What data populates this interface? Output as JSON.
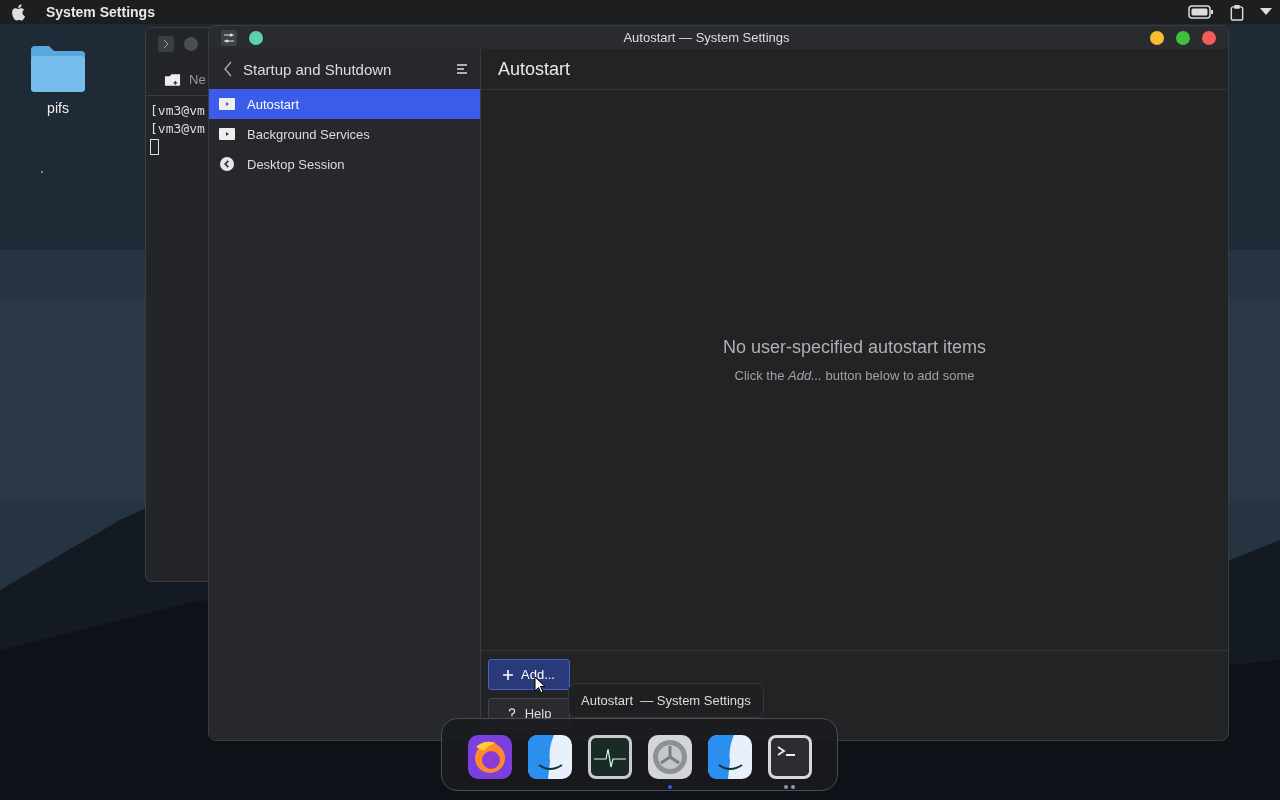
{
  "menubar": {
    "app_name": "System Settings"
  },
  "desktop_icons": [
    {
      "label": "pifs"
    }
  ],
  "terminal": {
    "toolbar_label": "Ne",
    "lines": [
      "[vm3@vm",
      "[vm3@vm"
    ]
  },
  "settings_window": {
    "title": "Autostart — System Settings",
    "sidebar": {
      "title": "Startup and Shutdown",
      "items": [
        {
          "label": "Autostart",
          "kind": "play",
          "selected": true
        },
        {
          "label": "Background Services",
          "kind": "play",
          "selected": false
        },
        {
          "label": "Desktop Session",
          "kind": "back",
          "selected": false
        }
      ]
    },
    "page_title": "Autostart",
    "empty_state": {
      "heading": "No user-specified autostart items",
      "hint": "Click the *Add...* button below to add some"
    },
    "buttons": [
      {
        "label": "Add...",
        "kind": "add",
        "highlighted": true
      },
      {
        "label": "Help",
        "kind": "help",
        "highlighted": false
      }
    ]
  },
  "tooltip": "Autostart  — System Settings",
  "dock": {
    "items": [
      {
        "kind": "browser"
      },
      {
        "kind": "files"
      },
      {
        "kind": "monitor"
      },
      {
        "kind": "settings",
        "indicators": [
          {
            "highlighted": true
          }
        ]
      },
      {
        "kind": "files"
      },
      {
        "kind": "terminal",
        "indicators": [
          {
            "highlighted": false
          },
          {
            "highlighted": false
          }
        ]
      }
    ]
  }
}
